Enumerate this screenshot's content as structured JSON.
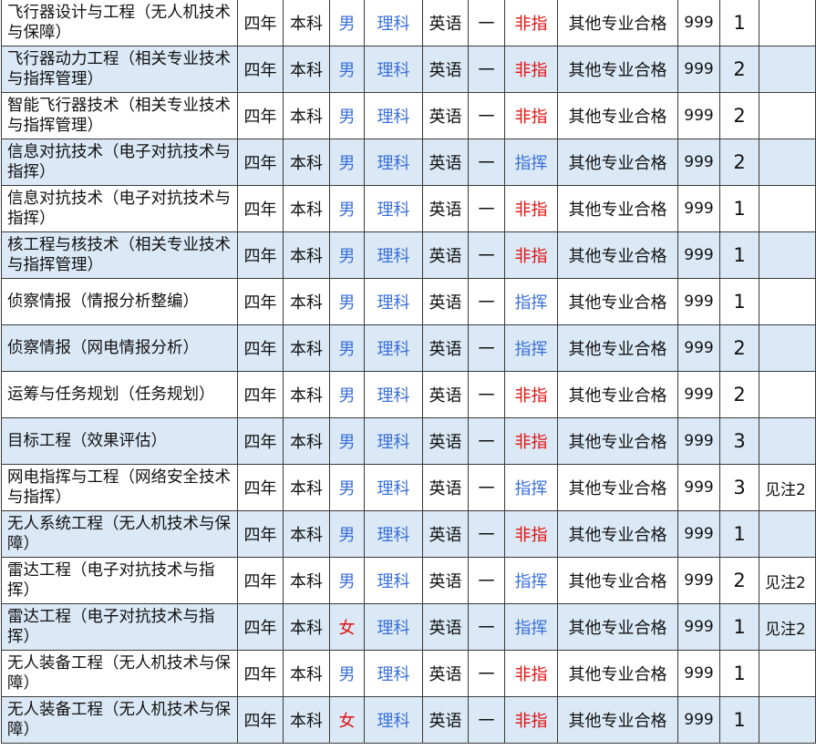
{
  "colors": {
    "row_shade": "#dbe9f6",
    "border": "#3a3a3a",
    "blue_text": "#3a6fd8",
    "red_text": "#e01010",
    "text": "#111111"
  },
  "rows": [
    {
      "name": "飞行器设计与工程（无人机技术与保障）",
      "years": "四年",
      "level": "本科",
      "gender": "男",
      "subject": "理科",
      "lang": "英语",
      "dash": "一",
      "type": "非指",
      "req": "其他专业合格",
      "score": "999",
      "count": "1",
      "note": ""
    },
    {
      "name": "飞行器动力工程（相关专业技术与指挥管理）",
      "years": "四年",
      "level": "本科",
      "gender": "男",
      "subject": "理科",
      "lang": "英语",
      "dash": "一",
      "type": "非指",
      "req": "其他专业合格",
      "score": "999",
      "count": "2",
      "note": ""
    },
    {
      "name": "智能飞行器技术（相关专业技术与指挥管理）",
      "years": "四年",
      "level": "本科",
      "gender": "男",
      "subject": "理科",
      "lang": "英语",
      "dash": "一",
      "type": "非指",
      "req": "其他专业合格",
      "score": "999",
      "count": "2",
      "note": ""
    },
    {
      "name": "信息对抗技术（电子对抗技术与指挥）",
      "years": "四年",
      "level": "本科",
      "gender": "男",
      "subject": "理科",
      "lang": "英语",
      "dash": "一",
      "type": "指挥",
      "req": "其他专业合格",
      "score": "999",
      "count": "2",
      "note": ""
    },
    {
      "name": "信息对抗技术（电子对抗技术与指挥）",
      "years": "四年",
      "level": "本科",
      "gender": "男",
      "subject": "理科",
      "lang": "英语",
      "dash": "一",
      "type": "非指",
      "req": "其他专业合格",
      "score": "999",
      "count": "1",
      "note": ""
    },
    {
      "name": "核工程与核技术（相关专业技术与指挥管理）",
      "years": "四年",
      "level": "本科",
      "gender": "男",
      "subject": "理科",
      "lang": "英语",
      "dash": "一",
      "type": "非指",
      "req": "其他专业合格",
      "score": "999",
      "count": "1",
      "note": ""
    },
    {
      "name": "侦察情报（情报分析整编）",
      "years": "四年",
      "level": "本科",
      "gender": "男",
      "subject": "理科",
      "lang": "英语",
      "dash": "一",
      "type": "指挥",
      "req": "其他专业合格",
      "score": "999",
      "count": "1",
      "note": ""
    },
    {
      "name": "侦察情报（网电情报分析）",
      "years": "四年",
      "level": "本科",
      "gender": "男",
      "subject": "理科",
      "lang": "英语",
      "dash": "一",
      "type": "指挥",
      "req": "其他专业合格",
      "score": "999",
      "count": "2",
      "note": ""
    },
    {
      "name": "运筹与任务规划（任务规划）",
      "years": "四年",
      "level": "本科",
      "gender": "男",
      "subject": "理科",
      "lang": "英语",
      "dash": "一",
      "type": "非指",
      "req": "其他专业合格",
      "score": "999",
      "count": "2",
      "note": ""
    },
    {
      "name": "目标工程（效果评估）",
      "years": "四年",
      "level": "本科",
      "gender": "男",
      "subject": "理科",
      "lang": "英语",
      "dash": "一",
      "type": "非指",
      "req": "其他专业合格",
      "score": "999",
      "count": "3",
      "note": ""
    },
    {
      "name": "网电指挥与工程（网络安全技术与指挥）",
      "years": "四年",
      "level": "本科",
      "gender": "男",
      "subject": "理科",
      "lang": "英语",
      "dash": "一",
      "type": "指挥",
      "req": "其他专业合格",
      "score": "999",
      "count": "3",
      "note": "见注2"
    },
    {
      "name": "无人系统工程（无人机技术与保障）",
      "years": "四年",
      "level": "本科",
      "gender": "男",
      "subject": "理科",
      "lang": "英语",
      "dash": "一",
      "type": "非指",
      "req": "其他专业合格",
      "score": "999",
      "count": "1",
      "note": ""
    },
    {
      "name": "雷达工程（电子对抗技术与指挥）",
      "years": "四年",
      "level": "本科",
      "gender": "男",
      "subject": "理科",
      "lang": "英语",
      "dash": "一",
      "type": "指挥",
      "req": "其他专业合格",
      "score": "999",
      "count": "2",
      "note": "见注2"
    },
    {
      "name": "雷达工程（电子对抗技术与指挥）",
      "years": "四年",
      "level": "本科",
      "gender": "女",
      "subject": "理科",
      "lang": "英语",
      "dash": "一",
      "type": "指挥",
      "req": "其他专业合格",
      "score": "999",
      "count": "1",
      "note": "见注2"
    },
    {
      "name": "无人装备工程（无人机技术与保障）",
      "years": "四年",
      "level": "本科",
      "gender": "男",
      "subject": "理科",
      "lang": "英语",
      "dash": "一",
      "type": "非指",
      "req": "其他专业合格",
      "score": "999",
      "count": "1",
      "note": ""
    },
    {
      "name": "无人装备工程（无人机技术与保障）",
      "years": "四年",
      "level": "本科",
      "gender": "女",
      "subject": "理科",
      "lang": "英语",
      "dash": "一",
      "type": "非指",
      "req": "其他专业合格",
      "score": "999",
      "count": "1",
      "note": ""
    }
  ]
}
